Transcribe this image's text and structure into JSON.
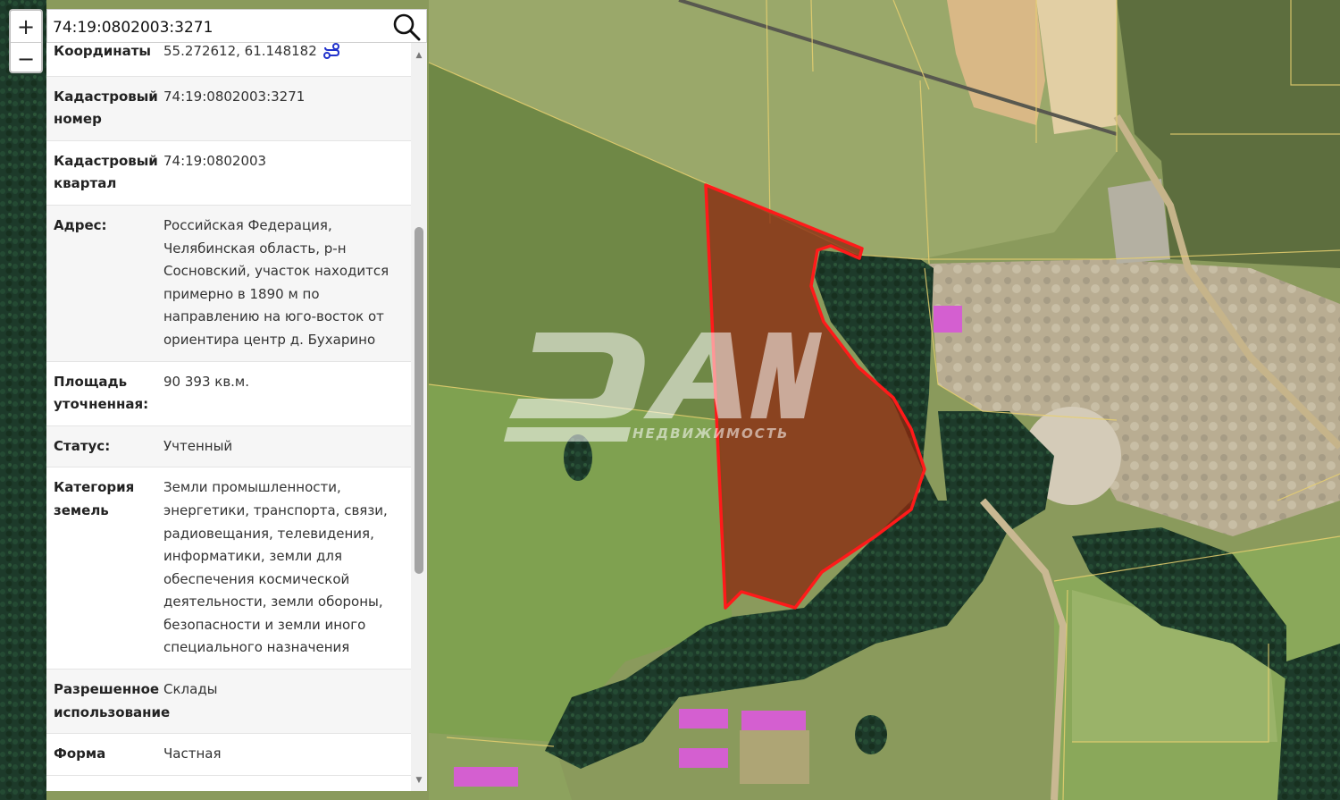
{
  "search": {
    "value": "74:19:0802003:3271",
    "icon": "search-icon"
  },
  "zoom": {
    "in_label": "+",
    "out_label": "−"
  },
  "info": {
    "rows": [
      {
        "label": "Координаты",
        "value": "55.272612, 61.148182"
      },
      {
        "label": "Кадастровый номер",
        "value": "74:19:0802003:3271"
      },
      {
        "label": "Кадастровый квартал",
        "value": "74:19:0802003"
      },
      {
        "label": "Адрес:",
        "value": "Российская Федерация, Челябинская область, р-н Сосновский, участок находится примерно в 1890 м по направлению на юго-восток от ориентира центр д. Бухарино"
      },
      {
        "label": "Площадь уточненная:",
        "value": "90 393 кв.м."
      },
      {
        "label": "Статус:",
        "value": "Учтенный"
      },
      {
        "label": "Категория земель",
        "value": "Земли промышленности, энергетики, транспорта, связи, радиовещания, телевидения, информатики, земли для обеспечения космической деятельности, земли обороны, безопасности и земли иного специального назначения"
      },
      {
        "label": "Разрешенное использование",
        "value": "Склады"
      },
      {
        "label": "Форма",
        "value": "Частная"
      }
    ]
  },
  "watermark": {
    "brand": "DAN",
    "subtitle": "НЕДВИЖИМОСТЬ"
  },
  "colors": {
    "parcel_outline": "#ff1a1a",
    "parcel_fill": "#8b2a10",
    "boundary_lines": "#e8d070",
    "building": "#d45fd0"
  }
}
